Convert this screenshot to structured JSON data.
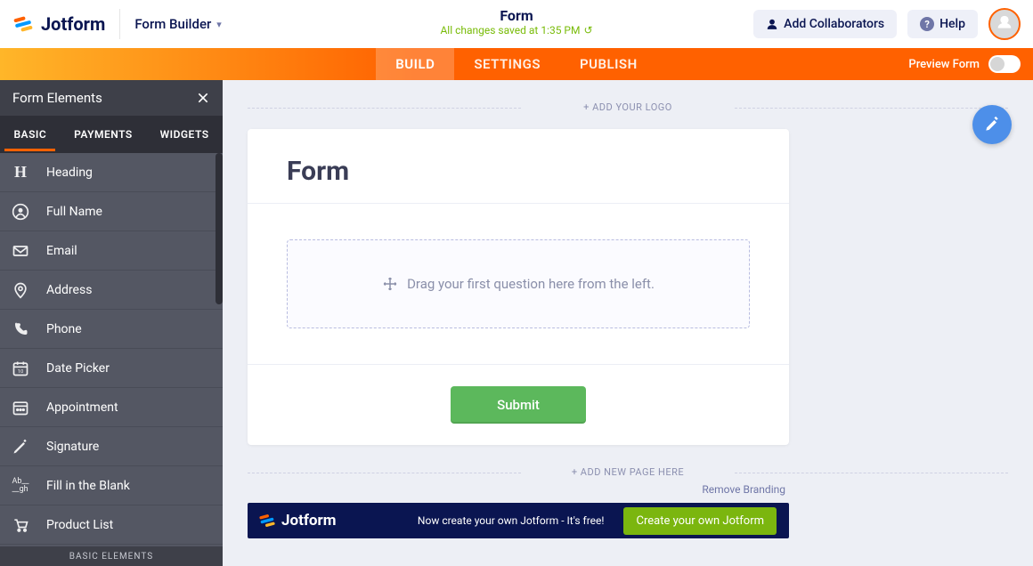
{
  "header": {
    "brand": "Jotform",
    "form_builder_label": "Form Builder",
    "title": "Form",
    "saved_status": "All changes saved at 1:35 PM",
    "add_collaborators": "Add Collaborators",
    "help": "Help"
  },
  "nav": {
    "tabs": [
      "BUILD",
      "SETTINGS",
      "PUBLISH"
    ],
    "preview_label": "Preview Form"
  },
  "sidebar": {
    "title": "Form Elements",
    "tabs": [
      "BASIC",
      "PAYMENTS",
      "WIDGETS"
    ],
    "items": [
      {
        "label": "Heading",
        "icon": "heading"
      },
      {
        "label": "Full Name",
        "icon": "user"
      },
      {
        "label": "Email",
        "icon": "mail"
      },
      {
        "label": "Address",
        "icon": "pin"
      },
      {
        "label": "Phone",
        "icon": "phone"
      },
      {
        "label": "Date Picker",
        "icon": "date"
      },
      {
        "label": "Appointment",
        "icon": "appointment"
      },
      {
        "label": "Signature",
        "icon": "signature"
      },
      {
        "label": "Fill in the Blank",
        "icon": "fill"
      },
      {
        "label": "Product List",
        "icon": "cart"
      }
    ],
    "footer": "BASIC ELEMENTS"
  },
  "canvas": {
    "add_logo": "+ ADD YOUR LOGO",
    "form_title": "Form",
    "drop_hint": "Drag your first question here from the left.",
    "submit": "Submit",
    "add_page": "+ ADD NEW PAGE HERE",
    "remove_branding": "Remove Branding"
  },
  "promo": {
    "brand": "Jotform",
    "text": "Now create your own Jotform - It's free!",
    "cta": "Create your own Jotform"
  }
}
